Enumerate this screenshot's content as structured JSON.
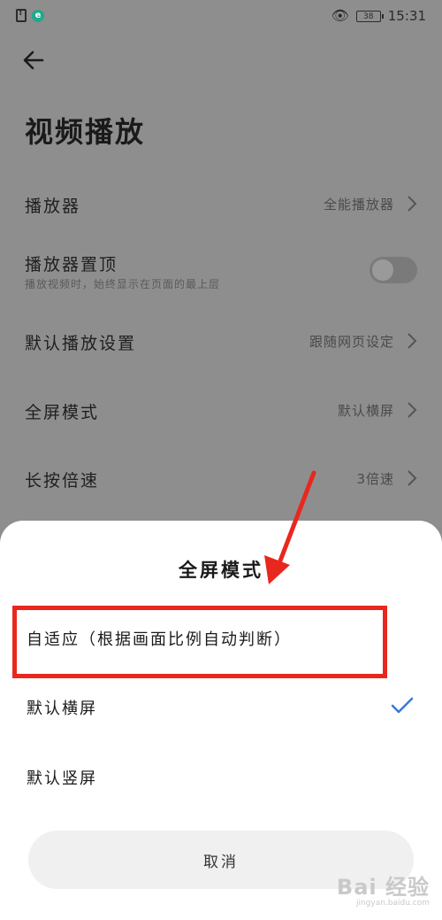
{
  "status_bar": {
    "app_badge": "e",
    "battery": "38",
    "time": "15:31"
  },
  "page": {
    "title": "视频播放",
    "rows": [
      {
        "label": "播放器",
        "value": "全能播放器"
      },
      {
        "label": "播放器置顶",
        "sub": "播放视频时，始终显示在页面的最上层",
        "toggle_on": false
      },
      {
        "label": "默认播放设置",
        "value": "跟随网页设定"
      },
      {
        "label": "全屏模式",
        "value": "默认横屏"
      },
      {
        "label": "长按倍速",
        "value": "3倍速"
      }
    ]
  },
  "sheet": {
    "title": "全屏模式",
    "options": [
      {
        "label": "自适应（根据画面比例自动判断）",
        "selected": false
      },
      {
        "label": "默认横屏",
        "selected": true
      },
      {
        "label": "默认竖屏",
        "selected": false
      }
    ],
    "cancel_label": "取消"
  },
  "watermark": {
    "logo": "Bai 经验",
    "url": "jingyan.baidu.com"
  },
  "colors": {
    "accent": "#3a7bd5",
    "annotation": "#e8281e",
    "overlay_bg": "#8e8e8e"
  },
  "icons": [
    "sim-alert-icon",
    "eye-icon",
    "battery-icon",
    "back-arrow-icon",
    "chevron-right-icon",
    "check-icon"
  ]
}
